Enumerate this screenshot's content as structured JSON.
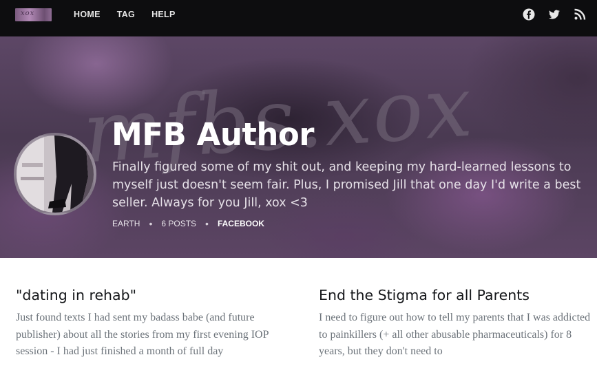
{
  "nav": {
    "logo_text": "xox",
    "links": [
      "HOME",
      "TAG",
      "HELP"
    ],
    "social_icons": [
      "facebook-icon",
      "twitter-icon",
      "rss-icon"
    ]
  },
  "hero": {
    "watermark": "mfbs.xox",
    "author_name": "MFB Author",
    "bio": "Finally figured some of my shit out, and keeping my hard-learned lessons to myself just doesn't seem fair. Plus, I promised Jill that one day I'd write a best seller. Always for you Jill, xox <3",
    "meta": {
      "location": "EARTH",
      "posts": "6 POSTS",
      "facebook": "FACEBOOK",
      "separator": "•"
    }
  },
  "posts": [
    {
      "title": "\"dating in rehab\"",
      "excerpt": "Just found texts I had sent my badass babe (and future publisher) about all the stories from my first evening IOP session - I had just finished a month of full day"
    },
    {
      "title": "End the Stigma for all Parents",
      "excerpt": "I need to figure out how to tell my parents that I was addicted to painkillers (+ all other abusable pharmaceuticals) for 8 years, but they don't need to"
    }
  ],
  "colors": {
    "nav_bg": "#0d0d0f",
    "hero_tint": "#5d4766",
    "title_text": "#15171a",
    "excerpt_text": "#6c737a"
  }
}
